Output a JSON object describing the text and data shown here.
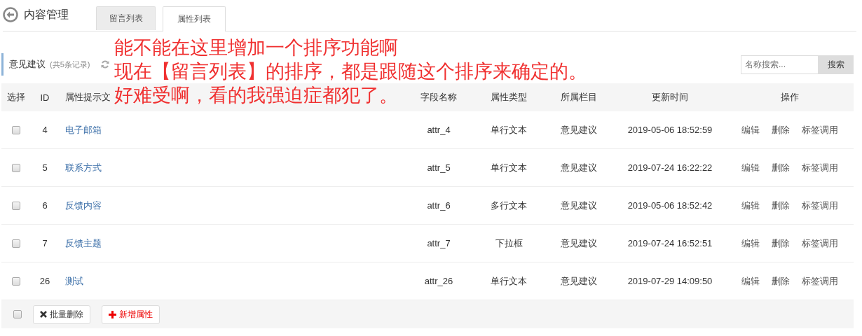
{
  "header": {
    "title": "内容管理",
    "tabs": [
      {
        "label": "留言列表",
        "selected": false
      },
      {
        "label": "属性列表",
        "selected": true
      }
    ]
  },
  "toolbar": {
    "title": "意见建议",
    "count": "(共5条记录)",
    "search": {
      "placeholder": "名称搜索..."
    },
    "search_button": "搜索"
  },
  "annotation": [
    "能不能在这里增加一个排序功能啊",
    "现在【留言列表】的排序，都是跟随这个排序来确定的。",
    "好难受啊，看的我强迫症都犯了。"
  ],
  "table": {
    "columns": [
      "选择",
      "ID",
      "属性提示文",
      "字段名称",
      "属性类型",
      "所属栏目",
      "更新时间",
      "操作"
    ],
    "rows": [
      {
        "checked": false,
        "id": "4",
        "name": "电子邮箱",
        "field": "attr_4",
        "type": "单行文本",
        "column": "意见建议",
        "time": "2019-05-06 18:52:59",
        "actions": [
          "编辑",
          "删除",
          "标签调用"
        ]
      },
      {
        "checked": false,
        "id": "5",
        "name": "联系方式",
        "field": "attr_5",
        "type": "单行文本",
        "column": "意见建议",
        "time": "2019-07-24 16:22:22",
        "actions": [
          "编辑",
          "删除",
          "标签调用"
        ]
      },
      {
        "checked": false,
        "id": "6",
        "name": "反馈内容",
        "field": "attr_6",
        "type": "多行文本",
        "column": "意见建议",
        "time": "2019-05-06 18:52:42",
        "actions": [
          "编辑",
          "删除",
          "标签调用"
        ]
      },
      {
        "checked": false,
        "id": "7",
        "name": "反馈主题",
        "field": "attr_7",
        "type": "下拉框",
        "column": "意见建议",
        "time": "2019-07-24 16:52:51",
        "actions": [
          "编辑",
          "删除",
          "标签调用"
        ]
      },
      {
        "checked": false,
        "id": "26",
        "name": "测试",
        "field": "attr_26",
        "type": "单行文本",
        "column": "意见建议",
        "time": "2019-07-29 14:09:50",
        "actions": [
          "编辑",
          "删除",
          "标签调用"
        ]
      }
    ]
  },
  "footer": {
    "select_all": {
      "checked": false
    },
    "buttons": [
      {
        "kind": "delete",
        "label": "批量删除"
      },
      {
        "kind": "add",
        "label": "新增属性"
      }
    ]
  }
}
